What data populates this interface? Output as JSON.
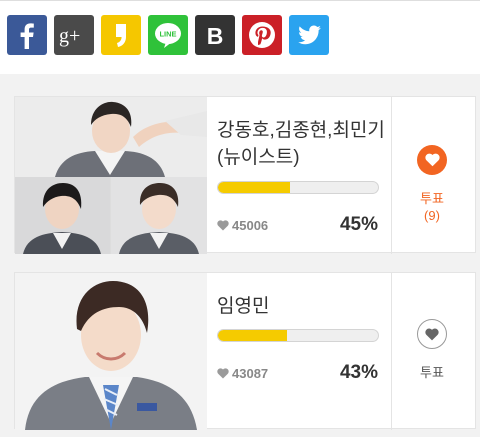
{
  "share": {
    "buttons": [
      {
        "name": "facebook",
        "icon": "facebook-icon",
        "glyph": "f",
        "color": "#3b5998"
      },
      {
        "name": "google-plus",
        "icon": "google-plus-icon",
        "glyph": "g+",
        "color": "#4a4a4a"
      },
      {
        "name": "kakaostory",
        "icon": "kakaostory-icon",
        "glyph": "",
        "color": "#f5c700"
      },
      {
        "name": "line",
        "icon": "line-icon",
        "glyph": "LINE",
        "color": "#2fc23a"
      },
      {
        "name": "blog",
        "icon": "blog-b-icon",
        "glyph": "B",
        "color": "#333333"
      },
      {
        "name": "pinterest",
        "icon": "pinterest-icon",
        "glyph": "P",
        "color": "#cb2027"
      },
      {
        "name": "twitter",
        "icon": "twitter-icon",
        "glyph": "",
        "color": "#2aa3ef"
      }
    ]
  },
  "candidates": [
    {
      "name_line1": "강동호,김종현,최민기",
      "name_line2": "(뉴이스트)",
      "vote_count": "45006",
      "percent": "45%",
      "progress": 0.45,
      "vote_label": "투표",
      "vote_count_label": "(9)",
      "voted": true,
      "photo_icon": "group-photo"
    },
    {
      "name_line1": "임영민",
      "name_line2": "",
      "vote_count": "43087",
      "percent": "43%",
      "progress": 0.43,
      "vote_label": "투표",
      "vote_count_label": "",
      "voted": false,
      "photo_icon": "portrait-photo"
    }
  ],
  "colors": {
    "accent": "#f26522",
    "bar": "#f5cb00",
    "vote_inactive": "#555555"
  }
}
